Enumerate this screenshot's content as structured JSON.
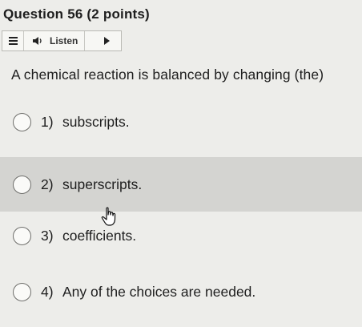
{
  "question": {
    "header": "Question 56 (2 points)",
    "text": "A chemical reaction is balanced by changing (the)"
  },
  "toolbar": {
    "menu_icon": "hamburger-menu-icon",
    "listen_label": "Listen",
    "speaker_icon": "speaker-icon",
    "play_icon": "play-icon"
  },
  "options": [
    {
      "number": "1)",
      "text": "subscripts.",
      "highlighted": false
    },
    {
      "number": "2)",
      "text": "superscripts.",
      "highlighted": true
    },
    {
      "number": "3)",
      "text": "coefficients.",
      "highlighted": false
    },
    {
      "number": "4)",
      "text": "Any of the choices are needed.",
      "highlighted": false
    }
  ],
  "colors": {
    "background": "#ededea",
    "highlight": "#d4d4d1",
    "text": "#1e1e1e"
  },
  "cursor_icon": "hand-pointer-icon"
}
